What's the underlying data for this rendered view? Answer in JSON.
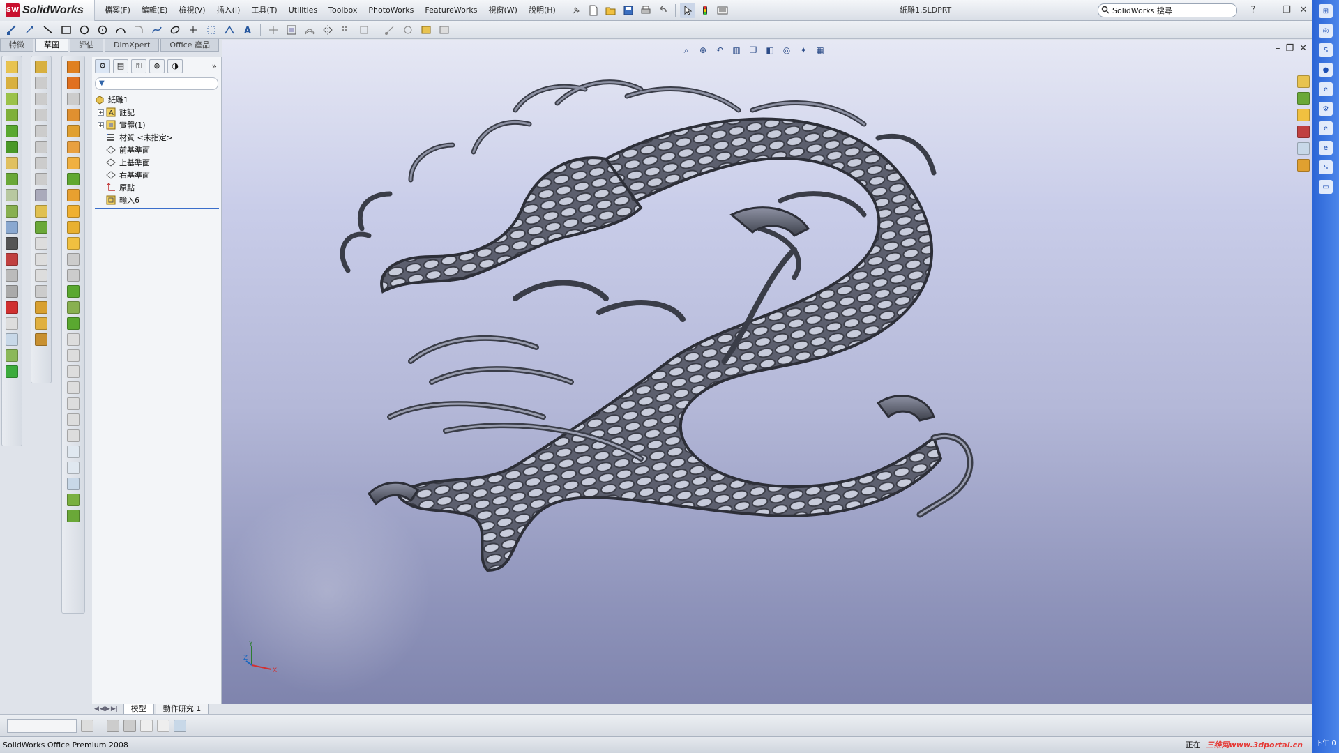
{
  "app": {
    "logo_mark": "SW",
    "logo_text": "SolidWorks",
    "document_title": "紙雕1.SLDPRT",
    "search_label": "SolidWorks 搜尋"
  },
  "menu": [
    "檔案(F)",
    "編輯(E)",
    "檢視(V)",
    "插入(I)",
    "工具(T)",
    "Utilities",
    "Toolbox",
    "PhotoWorks",
    "FeatureWorks",
    "視窗(W)",
    "說明(H)"
  ],
  "window_controls": {
    "help": "?",
    "minimize": "–",
    "restore": "❐",
    "close": "✕"
  },
  "command_tabs": [
    "特徵",
    "草圖",
    "評估",
    "DimXpert",
    "Office 產品"
  ],
  "feature_manager": {
    "tabs": [
      "⚙",
      "▤",
      "⚿",
      "⊕",
      "◑"
    ],
    "expand_label": "»",
    "filter_icon": "▼",
    "tree": [
      {
        "label": "紙雕1",
        "icon": "part-icon",
        "expander": "",
        "indent": 0
      },
      {
        "label": "註記",
        "icon": "annotation-icon",
        "expander": "+",
        "indent": 1
      },
      {
        "label": "實體(1)",
        "icon": "solid-bodies-icon",
        "expander": "+",
        "indent": 1
      },
      {
        "label": "材質 <未指定>",
        "icon": "material-icon",
        "expander": "",
        "indent": 1
      },
      {
        "label": "前基準面",
        "icon": "plane-icon",
        "expander": "",
        "indent": 1
      },
      {
        "label": "上基準面",
        "icon": "plane-icon",
        "expander": "",
        "indent": 1
      },
      {
        "label": "右基準面",
        "icon": "plane-icon",
        "expander": "",
        "indent": 1
      },
      {
        "label": "原點",
        "icon": "origin-icon",
        "expander": "",
        "indent": 1
      },
      {
        "label": "輸入6",
        "icon": "imported-feature-icon",
        "expander": "",
        "indent": 1
      }
    ]
  },
  "viewport": {
    "tabs": [
      "模型",
      "動作研究 1"
    ],
    "triad": {
      "x": "X",
      "y": "Y",
      "z": "Z"
    }
  },
  "status_bar": {
    "product": "SolidWorks Office Premium 2008",
    "right_text": "正在",
    "watermark": "三维网www.3dportal.cn",
    "clock": "下午 0"
  },
  "colors": {
    "accent": "#3a6ecb",
    "brand": "#c8102e",
    "desktop": "#2c65d6"
  }
}
